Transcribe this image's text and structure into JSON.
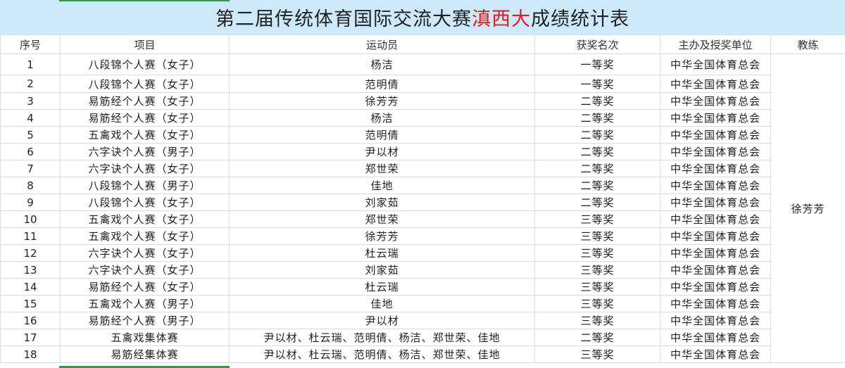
{
  "title": {
    "prefix": "第二届传统体育国际交流大赛",
    "highlight": "滇西大",
    "suffix": "成绩统计表",
    "highlight_color": "#e0191c",
    "background_color": "#cde9fb"
  },
  "columns": [
    "序号",
    "项目",
    "运动员",
    "获奖名次",
    "主办及授奖单位",
    "教练"
  ],
  "coach": "徐芳芳",
  "rows": [
    {
      "no": "1",
      "event": "八段锦个人赛（女子）",
      "athlete": "杨洁",
      "rank": "一等奖",
      "org": "中华全国体育总会"
    },
    {
      "no": "2",
      "event": "八段锦个人赛（女子）",
      "athlete": "范明倩",
      "rank": "一等奖",
      "org": "中华全国体育总会"
    },
    {
      "no": "3",
      "event": "易筋经个人赛（女子）",
      "athlete": "徐芳芳",
      "rank": "二等奖",
      "org": "中华全国体育总会"
    },
    {
      "no": "4",
      "event": "易筋经个人赛（女子）",
      "athlete": "杨洁",
      "rank": "二等奖",
      "org": "中华全国体育总会"
    },
    {
      "no": "5",
      "event": "五禽戏个人赛（女子）",
      "athlete": "范明倩",
      "rank": "二等奖",
      "org": "中华全国体育总会"
    },
    {
      "no": "6",
      "event": "六字诀个人赛（男子）",
      "athlete": "尹以材",
      "rank": "二等奖",
      "org": "中华全国体育总会"
    },
    {
      "no": "7",
      "event": "六字诀个人赛（女子）",
      "athlete": "郑世荣",
      "rank": "二等奖",
      "org": "中华全国体育总会"
    },
    {
      "no": "8",
      "event": "八段锦个人赛（男子）",
      "athlete": "佳地",
      "rank": "二等奖",
      "org": "中华全国体育总会"
    },
    {
      "no": "9",
      "event": "八段锦个人赛（女子）",
      "athlete": "刘家茹",
      "rank": "二等奖",
      "org": "中华全国体育总会"
    },
    {
      "no": "10",
      "event": "五禽戏个人赛（女子）",
      "athlete": "郑世荣",
      "rank": "三等奖",
      "org": "中华全国体育总会"
    },
    {
      "no": "11",
      "event": "五禽戏个人赛（女子）",
      "athlete": "徐芳芳",
      "rank": "三等奖",
      "org": "中华全国体育总会"
    },
    {
      "no": "12",
      "event": "六字诀个人赛（女子）",
      "athlete": "杜云瑞",
      "rank": "三等奖",
      "org": "中华全国体育总会"
    },
    {
      "no": "13",
      "event": "六字诀个人赛（女子）",
      "athlete": "刘家茹",
      "rank": "三等奖",
      "org": "中华全国体育总会"
    },
    {
      "no": "14",
      "event": "易筋经个人赛（女子）",
      "athlete": "杜云瑞",
      "rank": "三等奖",
      "org": "中华全国体育总会"
    },
    {
      "no": "15",
      "event": "五禽戏个人赛（男子）",
      "athlete": "佳地",
      "rank": "三等奖",
      "org": "中华全国体育总会"
    },
    {
      "no": "16",
      "event": "易筋经个人赛（男子）",
      "athlete": "尹以材",
      "rank": "三等奖",
      "org": "中华全国体育总会"
    },
    {
      "no": "17",
      "event": "五禽戏集体赛",
      "athlete": "尹以材、杜云瑞、范明倩、杨洁、郑世荣、佳地",
      "rank": "二等奖",
      "org": "中华全国体育总会"
    },
    {
      "no": "18",
      "event": "易筋经集体赛",
      "athlete": "尹以材、杜云瑞、范明倩、杨洁、郑世荣、佳地",
      "rank": "三等奖",
      "org": "中华全国体育总会"
    }
  ]
}
